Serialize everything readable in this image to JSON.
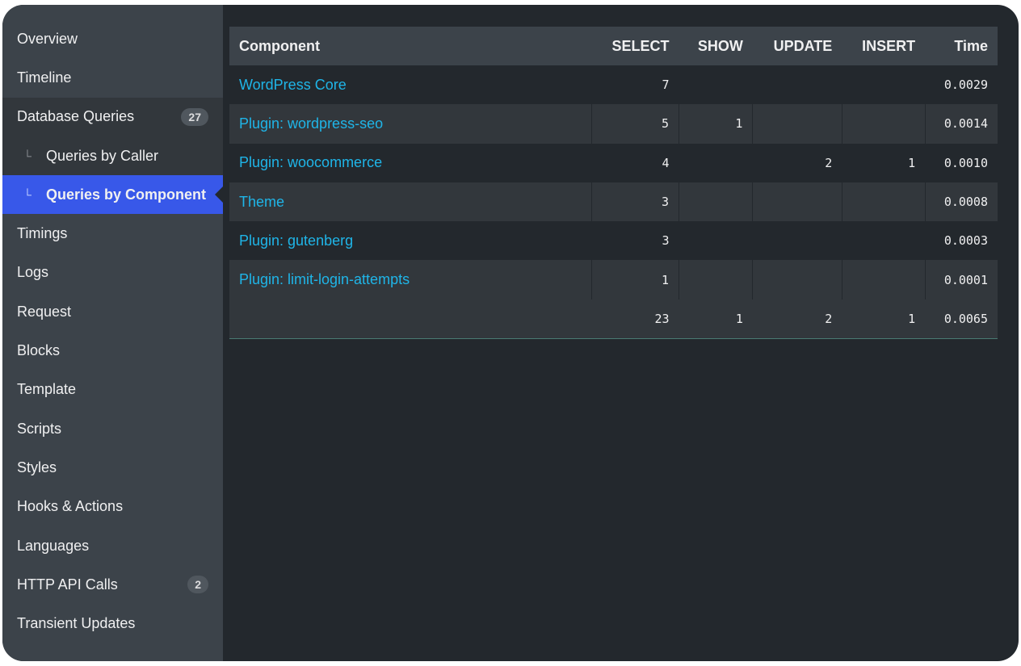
{
  "sidebar": {
    "items": [
      {
        "label": "Overview"
      },
      {
        "label": "Timeline"
      },
      {
        "label": "Database Queries",
        "badge": "27"
      },
      {
        "label": "Queries by Caller",
        "sub_mark": "└"
      },
      {
        "label": "Queries by Component",
        "sub_mark": "└"
      },
      {
        "label": "Timings"
      },
      {
        "label": "Logs"
      },
      {
        "label": "Request"
      },
      {
        "label": "Blocks"
      },
      {
        "label": "Template"
      },
      {
        "label": "Scripts"
      },
      {
        "label": "Styles"
      },
      {
        "label": "Hooks & Actions"
      },
      {
        "label": "Languages"
      },
      {
        "label": "HTTP API Calls",
        "badge": "2"
      },
      {
        "label": "Transient Updates"
      }
    ]
  },
  "table": {
    "headers": {
      "component": "Component",
      "select": "SELECT",
      "show": "SHOW",
      "update": "UPDATE",
      "insert": "INSERT",
      "time": "Time"
    },
    "rows": [
      {
        "component": "WordPress Core",
        "select": "7",
        "show": "",
        "update": "",
        "insert": "",
        "time": "0.0029"
      },
      {
        "component": "Plugin: wordpress-seo",
        "select": "5",
        "show": "1",
        "update": "",
        "insert": "",
        "time": "0.0014"
      },
      {
        "component": "Plugin: woocommerce",
        "select": "4",
        "show": "",
        "update": "2",
        "insert": "1",
        "time": "0.0010"
      },
      {
        "component": "Theme",
        "select": "3",
        "show": "",
        "update": "",
        "insert": "",
        "time": "0.0008"
      },
      {
        "component": "Plugin: gutenberg",
        "select": "3",
        "show": "",
        "update": "",
        "insert": "",
        "time": "0.0003"
      },
      {
        "component": "Plugin: limit-login-attempts",
        "select": "1",
        "show": "",
        "update": "",
        "insert": "",
        "time": "0.0001"
      }
    ],
    "totals": {
      "select": "23",
      "show": "1",
      "update": "2",
      "insert": "1",
      "time": "0.0065"
    }
  },
  "colors": {
    "accent": "#3858e9",
    "link": "#1fb5e8",
    "sidebar_bg": "#3c434a",
    "main_bg": "#23282d"
  }
}
